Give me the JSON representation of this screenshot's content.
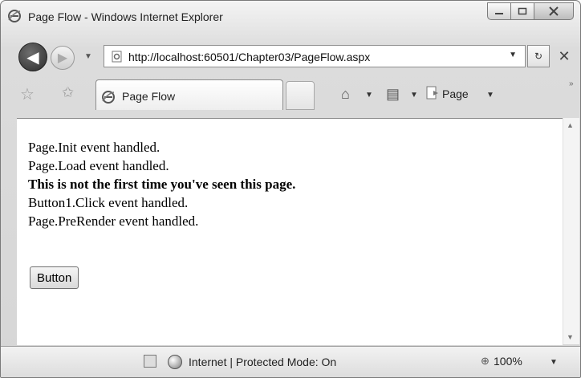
{
  "window": {
    "title": "Page Flow - Windows Internet Explorer"
  },
  "nav": {
    "back_glyph": "◀",
    "forward_glyph": "▶",
    "dropdown_glyph": "▼",
    "address": "http://localhost:60501/Chapter03/PageFlow.aspx",
    "refresh_glyph": "↻",
    "stop_glyph": "✕"
  },
  "tabs": {
    "favorites_glyph": "☆",
    "add_favorites_glyph": "✩",
    "active_tab_label": "Page Flow",
    "home_glyph": "⌂",
    "print_glyph": "▤",
    "page_menu_label": "Page",
    "more_glyph": "»"
  },
  "content": {
    "lines": [
      {
        "text": "Page.Init event handled.",
        "bold": false
      },
      {
        "text": "Page.Load event handled.",
        "bold": false
      },
      {
        "text": "This is not the first time you've seen this page.",
        "bold": true
      },
      {
        "text": "Button1.Click event handled.",
        "bold": false
      },
      {
        "text": "Page.PreRender event handled.",
        "bold": false
      }
    ],
    "button_label": "Button"
  },
  "status": {
    "zone_text": "Internet | Protected Mode: On",
    "zoom": "100%"
  }
}
